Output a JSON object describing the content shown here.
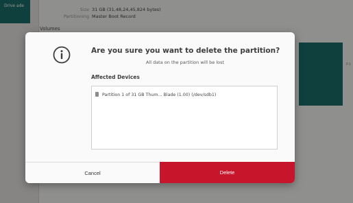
{
  "background": {
    "sidebar_selected_label": "Drive ade",
    "size_key": "Size",
    "size_value": "31 GB (31,48,24,45,824 bytes)",
    "partitioning_key": "Partitioning",
    "partitioning_value": "Master Boot Record",
    "volumes_label": "Volumes",
    "edge_text": "P 1"
  },
  "dialog": {
    "title": "Are you sure you want to delete the partition?",
    "subtitle": "All data on the partition will be lost",
    "affected_label": "Affected Devices",
    "devices": [
      "Partition 1 of 31 GB Thum... Blade (1.00) (/dev/sdb1)"
    ],
    "cancel_label": "Cancel",
    "delete_label": "Delete",
    "icon": "info-icon"
  },
  "colors": {
    "accent_teal": "#1b6f6a",
    "destructive_red": "#c7162b"
  }
}
